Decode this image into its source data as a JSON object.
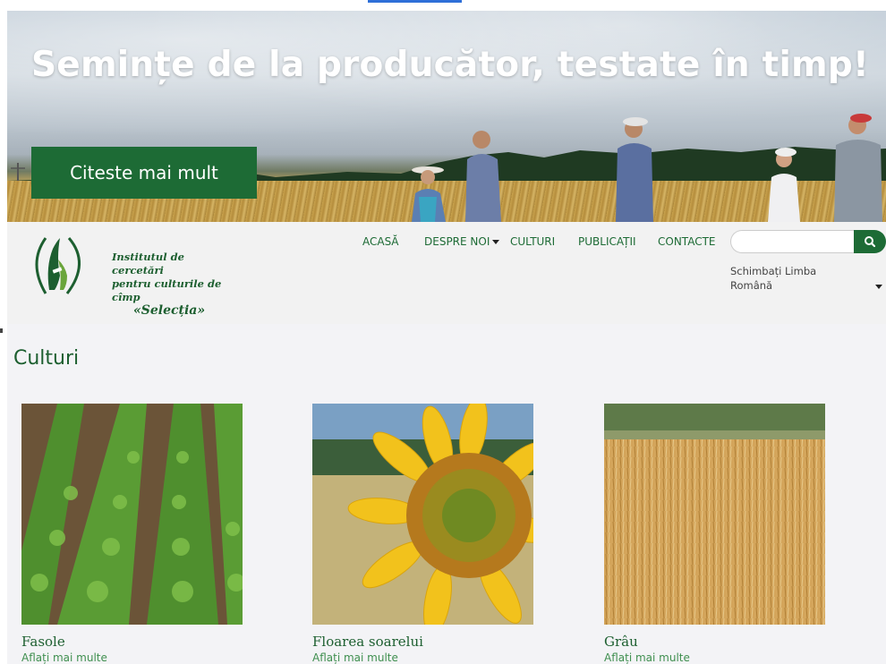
{
  "hero": {
    "headline": "Semințe de la producător, testate în timp!",
    "cta_label": "Citeste mai mult"
  },
  "logo": {
    "line1": "Institutul de cercetări",
    "line2": "pentru culturile de cîmp",
    "line3": "«Selecția»"
  },
  "nav": {
    "items": [
      {
        "label": "ACASĂ"
      },
      {
        "label": "DESPRE NOI"
      },
      {
        "label": "CULTURI"
      },
      {
        "label": "PUBLICAȚII"
      },
      {
        "label": "CONTACTE"
      }
    ]
  },
  "search": {
    "value": "",
    "icon": "search-icon"
  },
  "language": {
    "label": "Schimbați Limba",
    "selected": "Română"
  },
  "main": {
    "title": "Culturi",
    "cards": [
      {
        "name": "Fasole",
        "more": "Aflați mai multe"
      },
      {
        "name": "Floarea soarelui",
        "more": "Aflați mai multe"
      },
      {
        "name": "Grâu",
        "more": "Aflați mai multe"
      }
    ]
  },
  "colors": {
    "brand_green": "#1d6b35",
    "link_green": "#3f8f4f",
    "header_bg": "#f2f2f2",
    "main_bg": "#f3f3f6"
  }
}
